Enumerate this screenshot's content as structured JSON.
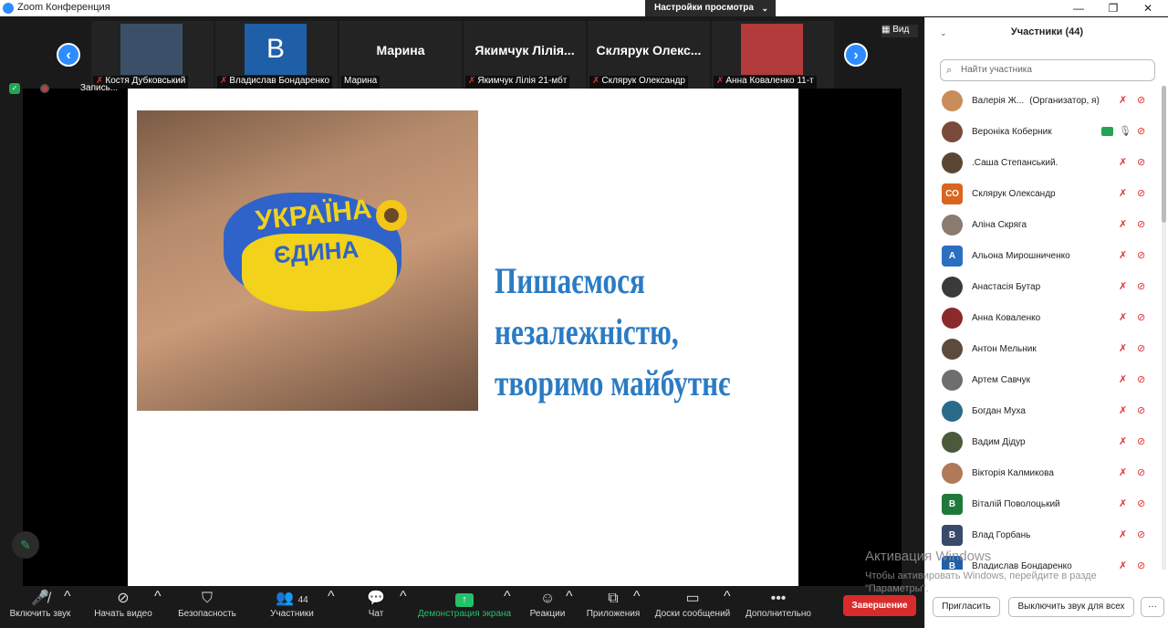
{
  "window": {
    "title": "Zoom Конференция",
    "view_settings": "Настройки просмотра",
    "minimize": "—",
    "restore": "❐",
    "close": "✕"
  },
  "gallery": {
    "prev": "‹",
    "next": "›",
    "view_label": "Вид",
    "tiles": [
      {
        "label": "Костя Дубковський",
        "big": "",
        "avatar_color": "#3b5068",
        "muted": true
      },
      {
        "label": "Владислав Бондаренко",
        "big": "B",
        "avatar_color": "#1f5fa8",
        "muted": true
      },
      {
        "label": "Марина",
        "big": "Марина",
        "avatar_color": "",
        "muted": false
      },
      {
        "label": "Якимчук Лілія 21-мбт",
        "big": "Якимчук Лілія...",
        "avatar_color": "",
        "muted": true
      },
      {
        "label": "Склярук Олександр",
        "big": "Склярук Олекс...",
        "avatar_color": "",
        "muted": true
      },
      {
        "label": "Анна Коваленко 11-т",
        "big": "",
        "avatar_color": "#b33b3b",
        "muted": true
      }
    ]
  },
  "recording": {
    "label": "Запись..."
  },
  "slide": {
    "photo_word1": "УКРАЇНА",
    "photo_word2": "ЄДИНА",
    "line1": "Пишаємося",
    "line2": "незалежністю,",
    "line3": "творимо майбутнє"
  },
  "toolbar": {
    "audio": "Включить звук",
    "video": "Начать видео",
    "security": "Безопасность",
    "participants": "Участники",
    "participants_count": "44",
    "chat": "Чат",
    "share": "Демонстрация экрана",
    "reactions": "Реакции",
    "apps": "Приложения",
    "whiteboards": "Доски сообщений",
    "more": "Дополнительно",
    "end": "Завершение"
  },
  "panel": {
    "title": "Участники (44)",
    "search_placeholder": "Найти участника",
    "invite": "Пригласить",
    "unmute_all": "Выключить звук для всех",
    "more": "···",
    "participants": [
      {
        "name": "Валерія Ж...",
        "role": "(Организатор, я)",
        "initials": "",
        "color": "#c98c5a"
      },
      {
        "name": "Вероніка Коберник",
        "role": "",
        "initials": "",
        "color": "#7a4a3a"
      },
      {
        "name": ".Саша Степанський.",
        "role": "",
        "initials": "",
        "color": "#5a4632"
      },
      {
        "name": "Склярук Олександр",
        "role": "",
        "initials": "СО",
        "color": "#d9661f"
      },
      {
        "name": "Аліна Скряга",
        "role": "",
        "initials": "",
        "color": "#8a7a70"
      },
      {
        "name": "Альона Мирошниченко",
        "role": "",
        "initials": "А",
        "color": "#2b6fc2"
      },
      {
        "name": "Анастасія Бутар",
        "role": "",
        "initials": "",
        "color": "#3a3a3a"
      },
      {
        "name": "Анна Коваленко",
        "role": "",
        "initials": "",
        "color": "#8a2a2a"
      },
      {
        "name": "Антон Мельник",
        "role": "",
        "initials": "",
        "color": "#5c4a3c"
      },
      {
        "name": "Артем Савчук",
        "role": "",
        "initials": "",
        "color": "#6e6e6e"
      },
      {
        "name": "Богдан Муха",
        "role": "",
        "initials": "",
        "color": "#2a6a8a"
      },
      {
        "name": "Вадим Дідур",
        "role": "",
        "initials": "",
        "color": "#4a5a3a"
      },
      {
        "name": "Вікторія Калмикова",
        "role": "",
        "initials": "",
        "color": "#b07a5a"
      },
      {
        "name": "Віталій Поволоцький",
        "role": "",
        "initials": "В",
        "color": "#1f7a3a"
      },
      {
        "name": "Влад Горбань",
        "role": "",
        "initials": "В",
        "color": "#3a4a6a"
      },
      {
        "name": "Владислав Бондаренко",
        "role": "",
        "initials": "В",
        "color": "#1f5fa8"
      }
    ]
  },
  "watermark": {
    "line1": "Активация Windows",
    "line2": "Чтобы активировать Windows, перейдите в разде",
    "line3": "\"Параметры\"."
  }
}
